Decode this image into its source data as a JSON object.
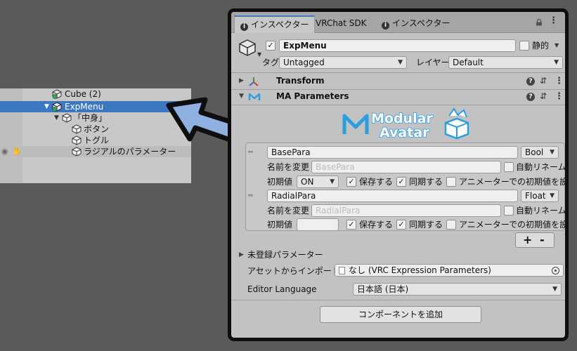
{
  "hierarchy": {
    "items": [
      {
        "label": "Cube (2)"
      },
      {
        "label": "ExpMenu"
      },
      {
        "label": "「中身」"
      },
      {
        "label": "ボタン"
      },
      {
        "label": "トグル"
      },
      {
        "label": "ラジアルのパラメーター"
      }
    ]
  },
  "inspector": {
    "tabs": [
      {
        "label": "インスペクター"
      },
      {
        "label": "VRChat SDK"
      },
      {
        "label": "インスペクター"
      }
    ],
    "object": {
      "name": "ExpMenu",
      "static_label": "静的",
      "tag_label": "タグ",
      "tag_value": "Untagged",
      "layer_label": "レイヤー",
      "layer_value": "Default"
    },
    "components": [
      {
        "name": "Transform"
      },
      {
        "name": "MA Parameters"
      }
    ],
    "logo": {
      "line1": "Modular",
      "line2": "Avatar"
    },
    "parameters": [
      {
        "name": "BasePara",
        "type": "Bool",
        "rename_label": "名前を変更",
        "rename_placeholder": "BasePara",
        "auto_rename_label": "自動リネーム",
        "default_label": "初期値",
        "default_value": "ON",
        "save_label": "保存する",
        "sync_label": "同期する",
        "animator_default_label": "アニメーターでの初期値を設定"
      },
      {
        "name": "RadialPara",
        "type": "Float",
        "rename_label": "名前を変更",
        "rename_placeholder": "RadialPara",
        "auto_rename_label": "自動リネーム",
        "default_label": "初期値",
        "default_value": "",
        "save_label": "保存する",
        "sync_label": "同期する",
        "animator_default_label": "アニメーターでの初期値を設定"
      }
    ],
    "plus_label": "+",
    "minus_label": "-",
    "unregistered_label": "未登録パラメーター",
    "import_label": "アセットからインポートする",
    "import_value": "なし (VRC Expression Parameters)",
    "editor_language_label": "Editor Language",
    "editor_language_value": "日本語 (日本)",
    "add_component_label": "コンポーネントを追加"
  },
  "colors": {
    "selection": "#3c78c0",
    "arrow_fill": "#8fb0e0",
    "logo": "#2a9fe0"
  }
}
